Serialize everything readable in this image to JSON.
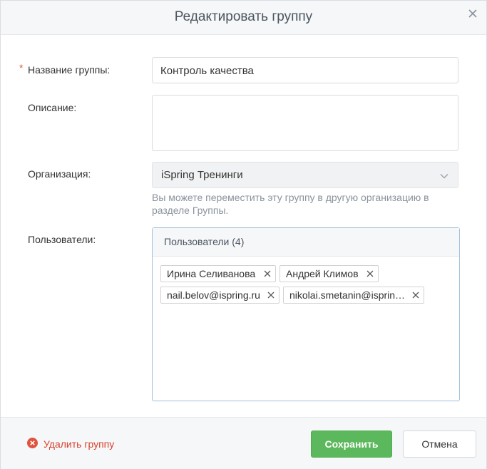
{
  "dialog": {
    "title": "Редактировать группу"
  },
  "form": {
    "name_label": "Название группы:",
    "name_value": "Контроль качества",
    "description_label": "Описание:",
    "description_value": "",
    "organization_label": "Организация:",
    "organization_value": "iSpring Тренинги",
    "organization_hint": "Вы можете переместить эту группу в другую организацию в разделе Группы.",
    "users_label": "Пользователи:",
    "users_header": "Пользователи (4)",
    "users": [
      "Ирина Селиванова",
      "Андрей Климов",
      "nail.belov@ispring.ru",
      "nikolai.smetanin@isprin…"
    ]
  },
  "footer": {
    "delete_label": "Удалить группу",
    "save_label": "Сохранить",
    "cancel_label": "Отмена"
  },
  "colors": {
    "accent_green": "#5cb85c",
    "danger_red": "#d9412f",
    "focus_blue": "#9fc1dc"
  },
  "icons": [
    "close-icon",
    "chevron-down-icon",
    "tag-remove-icon",
    "delete-circle-icon"
  ]
}
